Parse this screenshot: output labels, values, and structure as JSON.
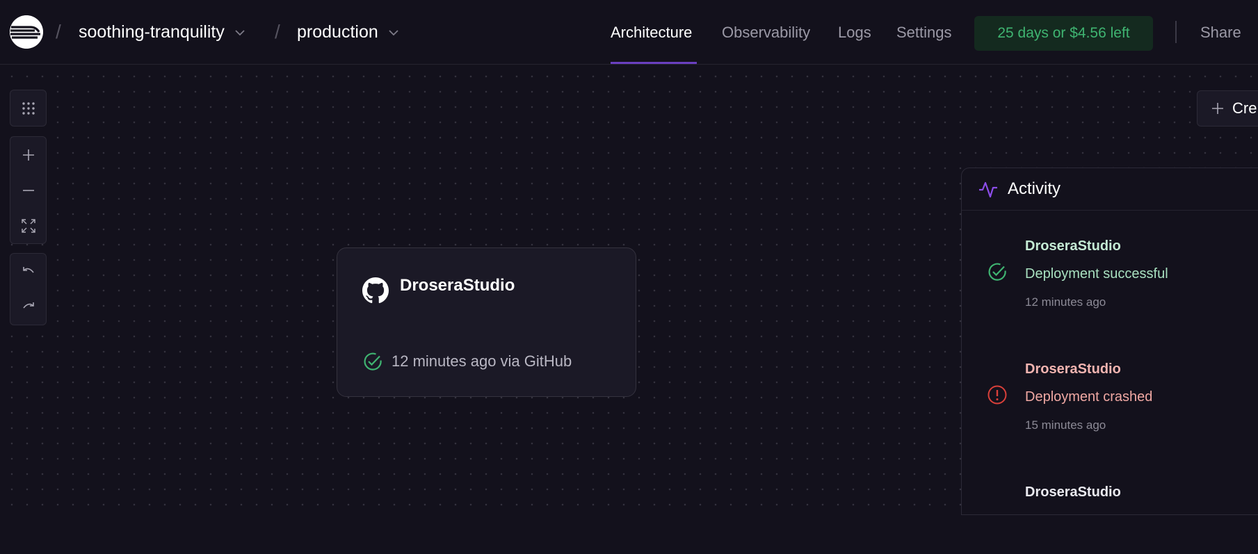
{
  "header": {
    "project": "soothing-tranquility",
    "environment": "production",
    "breadcrumb_separator": "/",
    "tabs": [
      {
        "label": "Architecture",
        "active": true
      },
      {
        "label": "Observability",
        "active": false
      },
      {
        "label": "Logs",
        "active": false
      },
      {
        "label": "Settings",
        "active": false
      }
    ],
    "trial_badge": "25 days or $4.56 left",
    "share_label": "Share"
  },
  "canvas": {
    "create_label": "Cre",
    "toolbar": [
      "grid-icon",
      "zoom-in-icon",
      "zoom-out-icon",
      "fit-view-icon",
      "undo-icon",
      "redo-icon"
    ]
  },
  "service": {
    "name": "DroseraStudio",
    "status_text": "12 minutes ago via GitHub",
    "icon": "github-icon",
    "status_icon": "check-circle-icon"
  },
  "activity": {
    "title": "Activity",
    "items": [
      {
        "name": "DroseraStudio",
        "message": "Deployment successful",
        "time": "12 minutes ago",
        "status": "success"
      },
      {
        "name": "DroseraStudio",
        "message": "Deployment crashed",
        "time": "15 minutes ago",
        "status": "crashed"
      },
      {
        "name": "DroseraStudio",
        "message": "",
        "time": "",
        "status": ""
      }
    ]
  },
  "colors": {
    "background": "#13111c",
    "accent": "#6a3fc0",
    "success": "#3fb471",
    "error": "#d9403a"
  }
}
